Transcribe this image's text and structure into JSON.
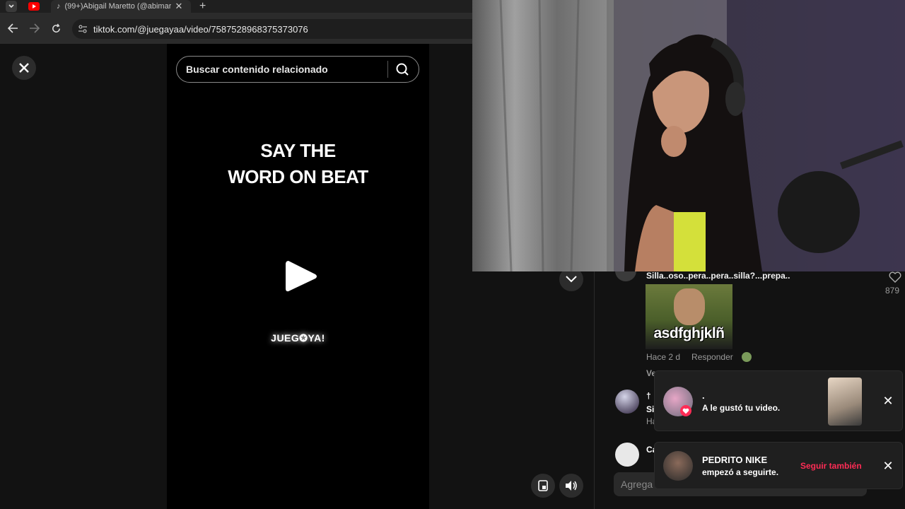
{
  "browser": {
    "tab_label": "(99+)Abigail Maretto (@abimar",
    "new_tab": "+",
    "url": "tiktok.com/@juegayaa/video/7587528968375373076"
  },
  "search": {
    "placeholder": "Buscar contenido relacionado"
  },
  "video": {
    "title_line1": "SAY THE",
    "title_line2": "WORD ON BEAT",
    "brand": "JUEG✪YA!"
  },
  "comments": {
    "c1": {
      "text": "Silla..oso..pera..pera..silla?...prepa..",
      "gif_text": "asdfghjklñ",
      "time": "Hace 2 d",
      "reply": "Responder",
      "likes": "879",
      "view_prefix": "Ve"
    },
    "c2": {
      "name": "†",
      "text": "Si",
      "meta": "Ha"
    },
    "c3": {
      "name": "Ca"
    },
    "input_placeholder": "Agrega"
  },
  "notifications": [
    {
      "title": ".",
      "text": "A le gustó tu video."
    },
    {
      "title": "PEDRITO NIKE",
      "text": "empezó a seguirte.",
      "action": "Seguir también"
    }
  ],
  "colors": {
    "accent_pink": "#fe2c55",
    "bg": "#121212"
  }
}
